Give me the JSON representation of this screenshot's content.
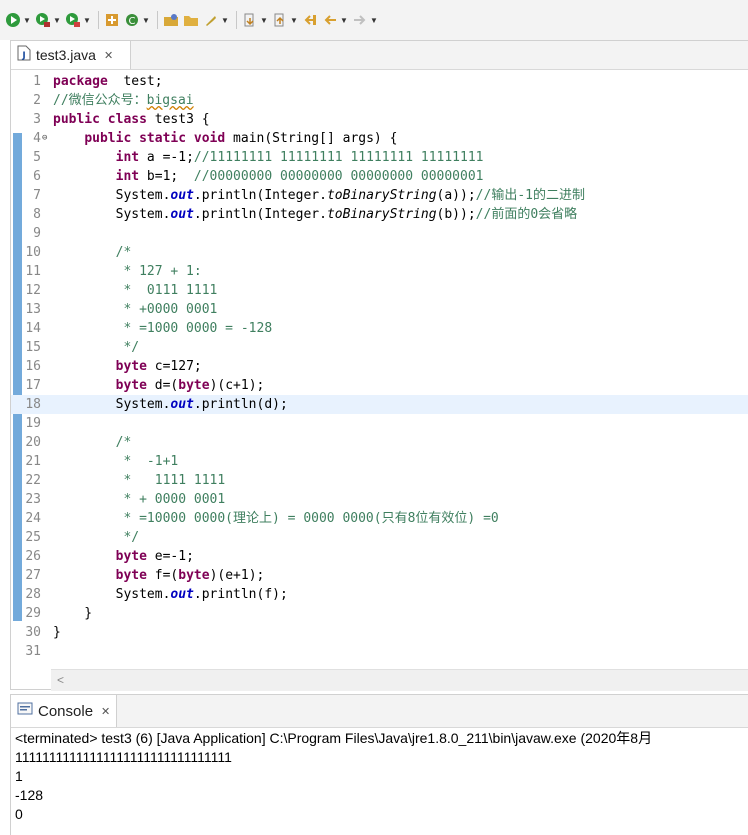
{
  "toolbar": {
    "icons": [
      "debug-icon",
      "run-icon",
      "coverage-icon",
      "external-tools-icon",
      "new-java-package-icon",
      "refresh-icon",
      "new-project-icon",
      "open-folder-icon",
      "pin-icon",
      "next-annotation-icon",
      "prev-annotation-icon",
      "last-edit-icon",
      "back-icon",
      "forward-icon"
    ]
  },
  "editor": {
    "tab_label": "test3.java",
    "tab_close": "✕",
    "lines": [
      {
        "n": "1",
        "tokens": [
          [
            "kw",
            "package"
          ],
          [
            "",
            "  test;"
          ]
        ]
      },
      {
        "n": "2",
        "tokens": [
          [
            "cm",
            "//微信公众号："
          ],
          [
            "cm sq",
            "bigsai"
          ]
        ]
      },
      {
        "n": "3",
        "tokens": [
          [
            "kw",
            "public"
          ],
          [
            "",
            " "
          ],
          [
            "kw",
            "class"
          ],
          [
            "",
            " test3 {"
          ]
        ]
      },
      {
        "n": "4",
        "fold": "⊖",
        "tokens": [
          [
            "",
            "    "
          ],
          [
            "kw",
            "public"
          ],
          [
            "",
            " "
          ],
          [
            "kw",
            "static"
          ],
          [
            "",
            " "
          ],
          [
            "kw",
            "void"
          ],
          [
            "",
            " main(String[] "
          ],
          [
            "",
            "args) {"
          ]
        ]
      },
      {
        "n": "5",
        "tokens": [
          [
            "",
            "        "
          ],
          [
            "kw",
            "int"
          ],
          [
            "",
            " a =-1;"
          ],
          [
            "cm",
            "//11111111 11111111 11111111 11111111"
          ]
        ]
      },
      {
        "n": "6",
        "tokens": [
          [
            "",
            "        "
          ],
          [
            "kw",
            "int"
          ],
          [
            "",
            " b=1;  "
          ],
          [
            "cm",
            "//00000000 00000000 00000000 00000001"
          ]
        ]
      },
      {
        "n": "7",
        "tokens": [
          [
            "",
            "        System."
          ],
          [
            "fld",
            "out"
          ],
          [
            "",
            ".println(Integer."
          ],
          [
            "sm",
            "toBinaryString"
          ],
          [
            "",
            "(a));"
          ],
          [
            "cm",
            "//输出-1的二进制"
          ]
        ]
      },
      {
        "n": "8",
        "tokens": [
          [
            "",
            "        System."
          ],
          [
            "fld",
            "out"
          ],
          [
            "",
            ".println(Integer."
          ],
          [
            "sm",
            "toBinaryString"
          ],
          [
            "",
            "(b));"
          ],
          [
            "cm",
            "//前面的0会省略"
          ]
        ]
      },
      {
        "n": "9",
        "tokens": []
      },
      {
        "n": "10",
        "tokens": [
          [
            "cm",
            "        /*"
          ]
        ]
      },
      {
        "n": "11",
        "tokens": [
          [
            "cm",
            "         * 127 + 1:"
          ]
        ]
      },
      {
        "n": "12",
        "tokens": [
          [
            "cm",
            "         *  0111 1111"
          ]
        ]
      },
      {
        "n": "13",
        "tokens": [
          [
            "cm",
            "         * +0000 0001"
          ]
        ]
      },
      {
        "n": "14",
        "tokens": [
          [
            "cm",
            "         * =1000 0000 = -128"
          ]
        ]
      },
      {
        "n": "15",
        "tokens": [
          [
            "cm",
            "         */"
          ]
        ]
      },
      {
        "n": "16",
        "tokens": [
          [
            "",
            "        "
          ],
          [
            "kw",
            "byte"
          ],
          [
            "",
            " c=127;"
          ]
        ]
      },
      {
        "n": "17",
        "tokens": [
          [
            "",
            "        "
          ],
          [
            "kw",
            "byte"
          ],
          [
            "",
            " d=("
          ],
          [
            "kw",
            "byte"
          ],
          [
            "",
            ")(c+1);"
          ]
        ]
      },
      {
        "n": "18",
        "cur": true,
        "tokens": [
          [
            "",
            "        System."
          ],
          [
            "fld",
            "out"
          ],
          [
            "",
            ".println(d);"
          ]
        ]
      },
      {
        "n": "19",
        "tokens": []
      },
      {
        "n": "20",
        "tokens": [
          [
            "cm",
            "        /*"
          ]
        ]
      },
      {
        "n": "21",
        "tokens": [
          [
            "cm",
            "         *  -1+1"
          ]
        ]
      },
      {
        "n": "22",
        "tokens": [
          [
            "cm",
            "         *   1111 1111"
          ]
        ]
      },
      {
        "n": "23",
        "tokens": [
          [
            "cm",
            "         * + 0000 0001"
          ]
        ]
      },
      {
        "n": "24",
        "tokens": [
          [
            "cm",
            "         * =10000 0000(理论上) = 0000 0000(只有8位有效位) =0"
          ]
        ]
      },
      {
        "n": "25",
        "tokens": [
          [
            "cm",
            "         */"
          ]
        ]
      },
      {
        "n": "26",
        "tokens": [
          [
            "",
            "        "
          ],
          [
            "kw",
            "byte"
          ],
          [
            "",
            " e=-1;"
          ]
        ]
      },
      {
        "n": "27",
        "tokens": [
          [
            "",
            "        "
          ],
          [
            "kw",
            "byte"
          ],
          [
            "",
            " f=("
          ],
          [
            "kw",
            "byte"
          ],
          [
            "",
            ")(e+1);"
          ]
        ]
      },
      {
        "n": "28",
        "tokens": [
          [
            "",
            "        System."
          ],
          [
            "fld",
            "out"
          ],
          [
            "",
            ".println(f);"
          ]
        ]
      },
      {
        "n": "29",
        "tokens": [
          [
            "",
            "    }"
          ]
        ]
      },
      {
        "n": "30",
        "tokens": [
          [
            "",
            "}"
          ]
        ]
      },
      {
        "n": "31",
        "tokens": []
      }
    ]
  },
  "console": {
    "tab_label": "Console",
    "tab_close": "✕",
    "header": "<terminated> test3 (6) [Java Application] C:\\Program Files\\Java\\jre1.8.0_211\\bin\\javaw.exe (2020年8月",
    "output": [
      "11111111111111111111111111111111",
      "1",
      "-128",
      "0"
    ]
  }
}
